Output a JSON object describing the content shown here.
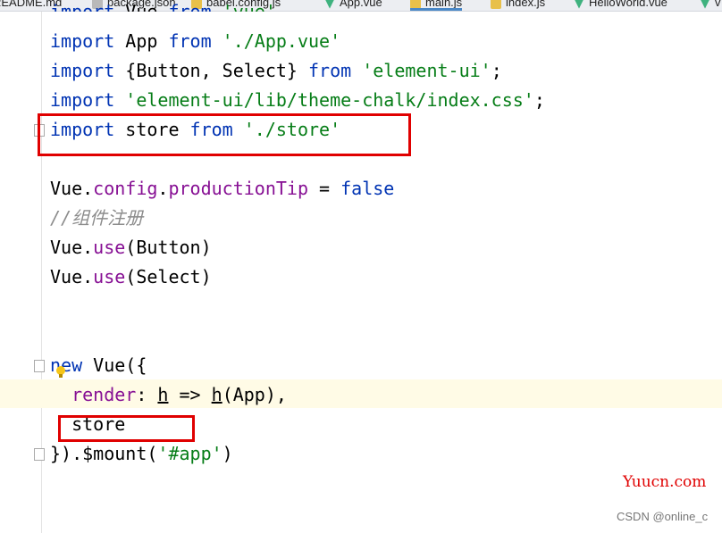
{
  "tabs": [
    {
      "label": "README.md",
      "icon": "markdown-icon"
    },
    {
      "label": "package.json",
      "icon": "json-icon"
    },
    {
      "label": "babel.config.js",
      "icon": "js-icon"
    },
    {
      "label": "App.vue",
      "icon": "vue-icon"
    },
    {
      "label": "main.js",
      "icon": "js-icon",
      "active": true
    },
    {
      "label": "index.js",
      "icon": "js-icon"
    },
    {
      "label": "HelloWorld.vue",
      "icon": "vue-icon"
    },
    {
      "label": "v",
      "icon": "vue-icon"
    }
  ],
  "code": {
    "l0": {
      "a": "import",
      "b": " Vue ",
      "c": "from",
      "d": " 'vue'"
    },
    "l1": {
      "a": "import",
      "b": " App ",
      "c": "from",
      "d": " './App.vue'"
    },
    "l2": {
      "a": "import",
      "b": " {Button, Select} ",
      "c": "from",
      "d": " 'element-ui'",
      "e": ";"
    },
    "l3": {
      "a": "import",
      "d": " 'element-ui/lib/theme-chalk/index.css'",
      "e": ";"
    },
    "l4": {
      "a": "import",
      "b": " store ",
      "c": "from",
      "d": " './store'"
    },
    "l6": {
      "a": "Vue.",
      "b": "config",
      "c": ".",
      "d": "productionTip",
      "e": " = ",
      "f": "false"
    },
    "l7": {
      "a": "//组件注册"
    },
    "l8": {
      "a": "Vue.",
      "b": "use",
      "c": "(Button)"
    },
    "l9": {
      "a": "Vue.",
      "b": "use",
      "c": "(Select)"
    },
    "l12": {
      "a": "new",
      "b": " Vue({"
    },
    "l13": {
      "a": "  render",
      "b": ": ",
      "c": "h",
      "d": " => ",
      "e": "h",
      "f": "(App),"
    },
    "l14": {
      "a": "  store"
    },
    "l15": {
      "a": "}).$mount(",
      "b": "'#app'",
      "c": ")"
    }
  },
  "watermarks": {
    "site": "Yuucn.com",
    "csdn": "CSDN @online_c"
  },
  "colors": {
    "keyword": "#0033b3",
    "string": "#067d17",
    "property": "#871094",
    "comment": "#8c8c8c",
    "highlight_box": "#e00000"
  }
}
